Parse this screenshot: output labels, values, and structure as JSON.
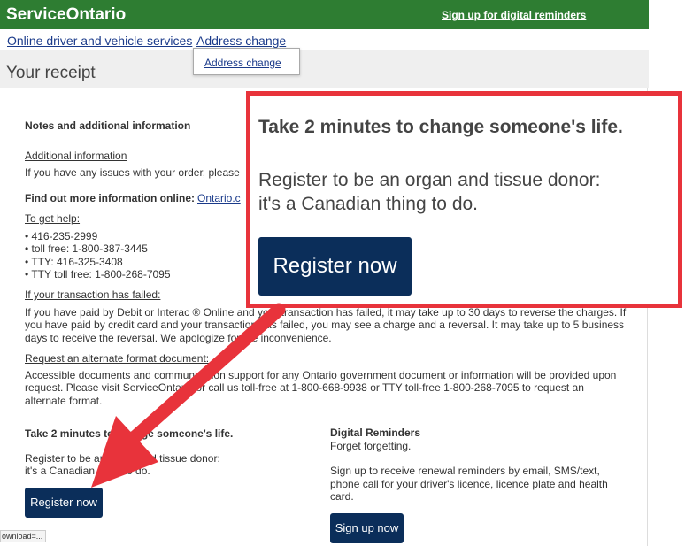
{
  "header": {
    "brand": "ServiceOntario",
    "signup_link": "Sign up for digital reminders"
  },
  "nav": {
    "items": [
      {
        "label": "Online driver and vehicle services"
      },
      {
        "label": "Address change"
      }
    ],
    "dropdown": {
      "items": [
        {
          "label": "Address change"
        }
      ]
    }
  },
  "page": {
    "title": "Your receipt"
  },
  "receipt": {
    "notes_heading": "Notes and additional information",
    "additional_info_link": "Additional information",
    "issues_text": "If you have any issues with your order, please",
    "find_out_more": "Find out more information online:",
    "find_out_more_link": "Ontario.c",
    "get_help_heading": "To get help:",
    "help_lines": [
      "• 416-235-2999",
      "• toll free: 1-800-387-3445",
      "• TTY: 416-325-3408",
      "• TTY toll free: 1-800-268-7095"
    ],
    "transaction_failed_heading": "If your transaction has failed:",
    "transaction_failed_text": [
      "If you have paid by Debit or Interac ® Online and your transaction has failed, it may take up to 30 days to reverse the charges. If",
      "you have paid by credit card and your transaction has failed, you may see a charge and a reversal. It may take up to 5 business",
      "days to receive the reversal. We apologize for the inconvenience."
    ],
    "alternate_format_heading": "Request an alternate format document:",
    "alternate_format_text": [
      "Accessible documents and communication support for any Ontario government document or information will be provided upon",
      "request. Please visit ServiceOntario or call us toll-free at 1-800-668-9938 or TTY toll-free 1-800-268-7095 to request an",
      "alternate format."
    ]
  },
  "donor": {
    "heading": "Take 2 minutes to change someone's life.",
    "line1": "Register to be an organ and tissue donor:",
    "line2": "it's a Canadian thing to do.",
    "button": "Register now"
  },
  "digital_reminders": {
    "heading": "Digital Reminders",
    "tagline": "Forget forgetting.",
    "body": [
      "Sign up to receive renewal reminders by email, SMS/text,",
      "phone call for your driver's licence, licence plate and health",
      "card."
    ],
    "button": "Sign up now"
  },
  "callout": {
    "heading": "Take 2 minutes to change someone's life.",
    "line1": "Register to be an organ and tissue donor:",
    "line2": "it's a Canadian thing to do.",
    "button": "Register now"
  },
  "status_bar": {
    "text": "ownload=..."
  },
  "colors": {
    "brand_green": "#2e7d32",
    "button_navy": "#0b2e5a",
    "callout_red": "#e8333b",
    "link_blue": "#1a3a8a"
  }
}
